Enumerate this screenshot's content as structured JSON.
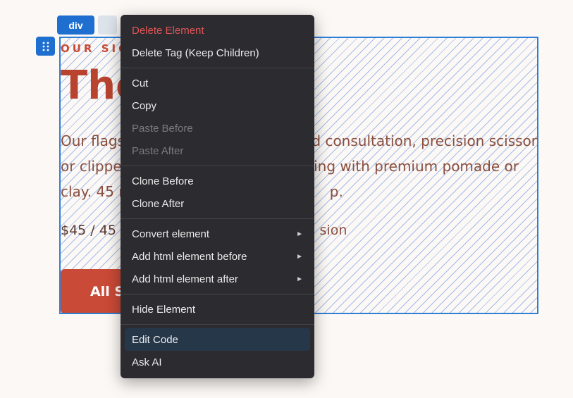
{
  "editor": {
    "element_tag": "div",
    "drag_icon": "drag-handle-icon"
  },
  "canvas": {
    "eyebrow": "OUR SIG",
    "headline": "The",
    "description_left": "Our flags",
    "description_right": "ed consultation, precision scissor",
    "description_line2_left": "or clipper",
    "description_line2_right": "rling with premium pomade or",
    "description_line3_left": "clay. 45 m",
    "description_line3_right": "p.",
    "price_left": "$45 / 45 m",
    "price_right": "sion",
    "button_label": "All S"
  },
  "context_menu": {
    "items": [
      {
        "label": "Delete Element",
        "state": "danger"
      },
      {
        "label": "Delete Tag (Keep Children)",
        "state": "normal"
      },
      {
        "label": "Cut",
        "state": "normal"
      },
      {
        "label": "Copy",
        "state": "normal"
      },
      {
        "label": "Paste Before",
        "state": "disabled"
      },
      {
        "label": "Paste After",
        "state": "disabled"
      },
      {
        "label": "Clone Before",
        "state": "normal"
      },
      {
        "label": "Clone After",
        "state": "normal"
      },
      {
        "label": "Convert element",
        "state": "submenu"
      },
      {
        "label": "Add html element before",
        "state": "submenu"
      },
      {
        "label": "Add html element after",
        "state": "submenu"
      },
      {
        "label": "Hide Element",
        "state": "normal"
      },
      {
        "label": "Edit Code",
        "state": "active"
      },
      {
        "label": "Ask AI",
        "state": "normal"
      }
    ],
    "submenu_arrow": "►"
  },
  "colors": {
    "accent": "#1f6fd1",
    "brand": "#c94a36",
    "menu_bg": "#2b2b30",
    "danger": "#e25555"
  }
}
